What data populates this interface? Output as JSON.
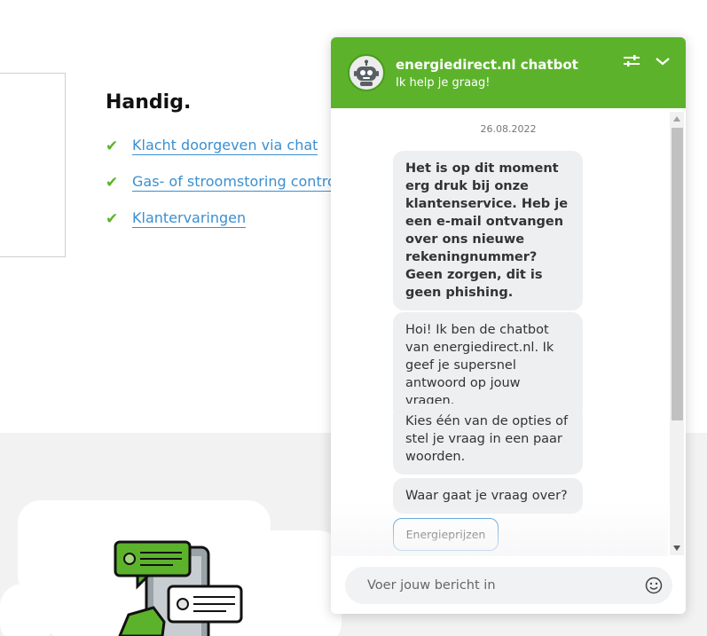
{
  "page": {
    "section_title": "Handig.",
    "links": [
      {
        "label": "Klacht doorgeven via chat",
        "icon": "check-icon"
      },
      {
        "label": "Gas- of stroomstoring controleren",
        "icon": "check-icon"
      },
      {
        "label": "Klantervaringen",
        "icon": "check-icon"
      }
    ]
  },
  "chat": {
    "title": "energiedirect.nl chatbot",
    "subtitle": "Ik help je graag!",
    "date": "26.08.2022",
    "messages": [
      {
        "text": "Het is op dit moment erg druk bij onze klantenservice. Heb je een e-mail ontvangen over ons nieuwe rekeningnummer? Geen zorgen, dit is geen phishing.",
        "bold": true
      },
      {
        "text": "Hoi! Ik ben de chatbot van energiedirect.nl. Ik geef je supersnel antwoord op jouw vragen.",
        "bold": false
      },
      {
        "text": "Kies één van de opties of stel je vraag in een paar woorden.",
        "bold": false
      },
      {
        "text": "Waar gaat je vraag over?",
        "bold": false
      }
    ],
    "options": [
      "Energieprijzen"
    ],
    "input_placeholder": "Voer jouw bericht in",
    "icons": {
      "settings": "sliders-icon",
      "minimize": "chevron-down-icon",
      "emoji": "smiley-icon",
      "avatar": "robot-icon"
    }
  },
  "colors": {
    "brand_green": "#5cb32b",
    "link_blue": "#3a8fd1",
    "bubble_grey": "#eeeff1"
  }
}
